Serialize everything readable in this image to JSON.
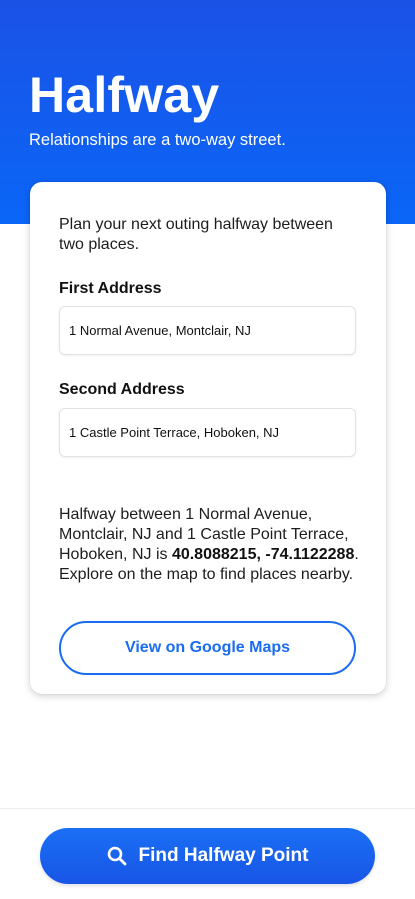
{
  "header": {
    "title": "Halfway",
    "tagline": "Relationships are a two-way street."
  },
  "form": {
    "intro": "Plan your next outing halfway between two places.",
    "first_label": "First Address",
    "first_value": "1 Normal Avenue, Montclair, NJ",
    "second_label": "Second Address",
    "second_value": "1 Castle Point Terrace, Hoboken, NJ"
  },
  "result": {
    "prefix": "Halfway between 1 Normal Avenue, Montclair, NJ and 1 Castle Point Terrace, Hoboken, NJ is ",
    "coordinates": "40.8088215, -74.1122288",
    "suffix": ". Explore on the map to find places nearby.",
    "maps_button": "View on Google Maps"
  },
  "footer": {
    "find_button": "Find Halfway Point",
    "icon": "search-icon"
  },
  "colors": {
    "brand_blue": "#1a6cf2",
    "hero_top": "#1b52e6",
    "hero_bottom": "#0a66f7"
  }
}
